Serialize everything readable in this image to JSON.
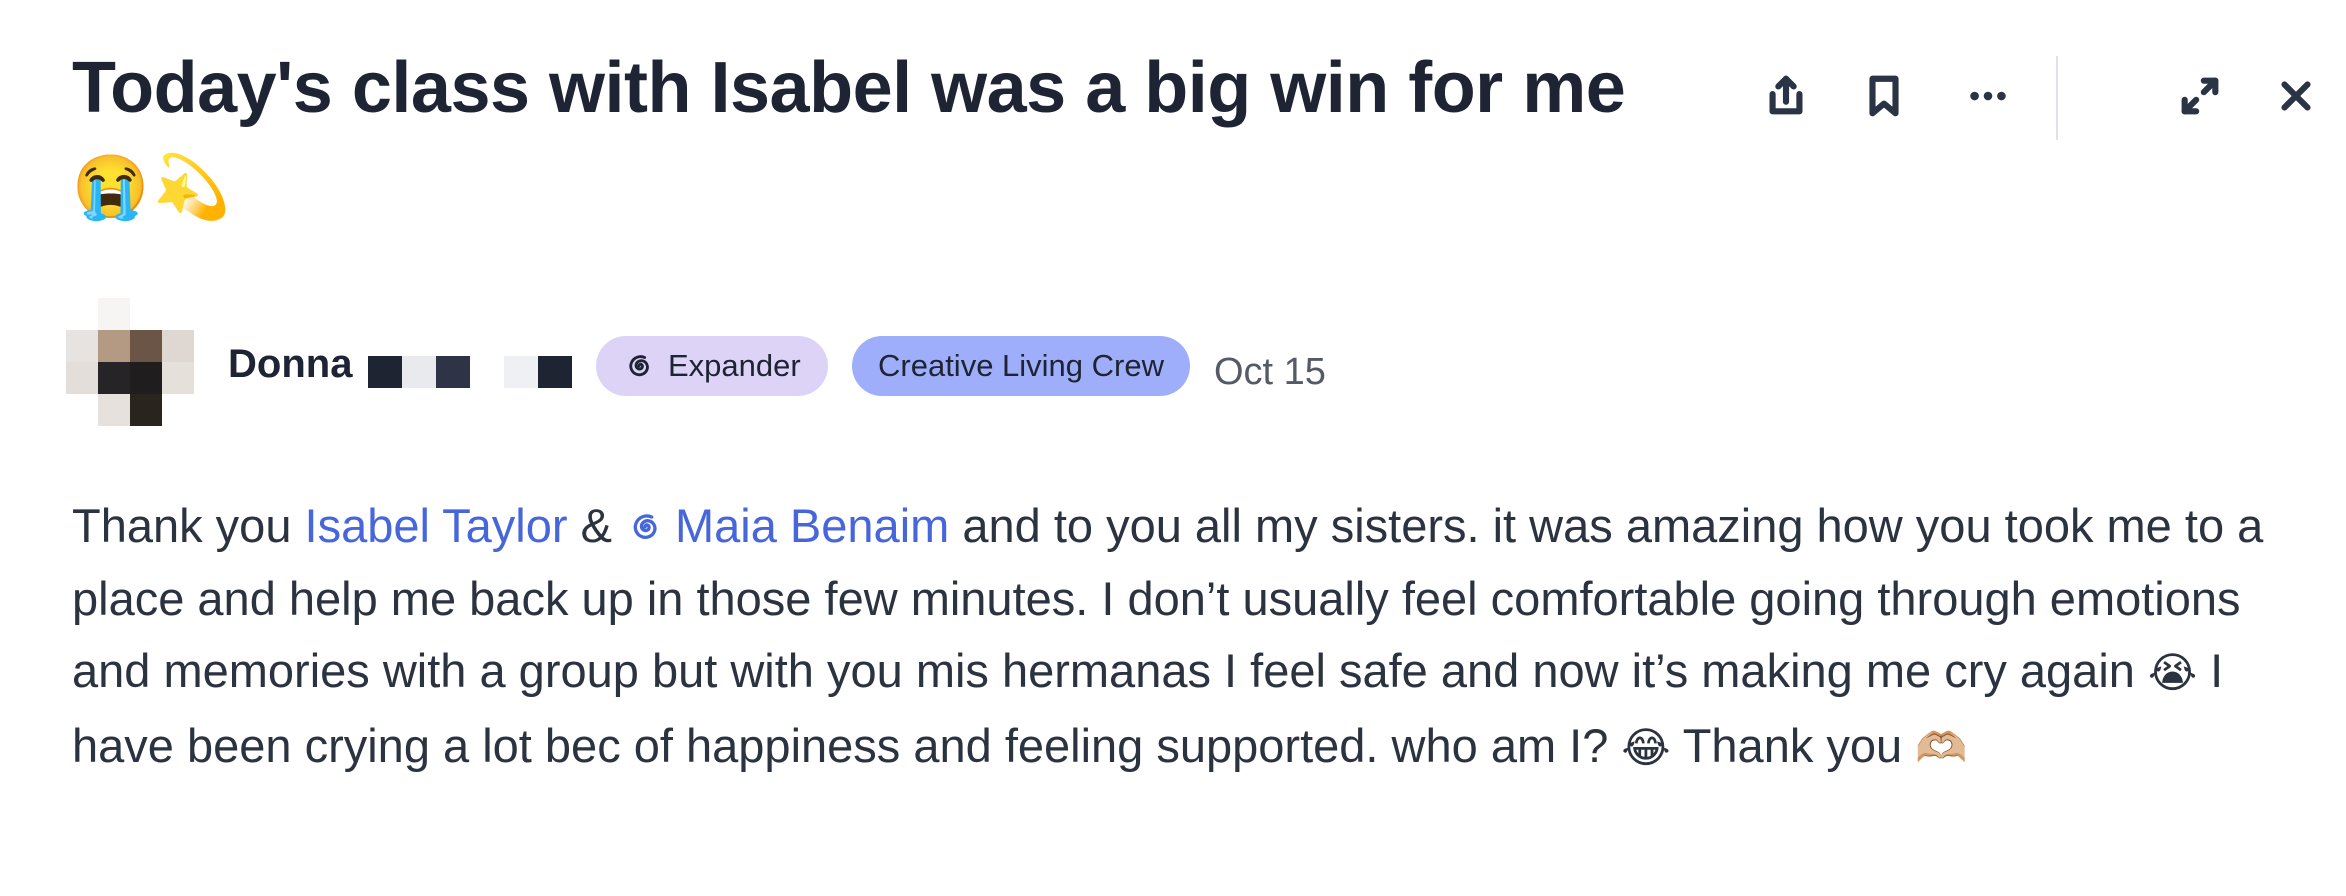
{
  "post": {
    "title": "Today's class with Isabel was a big win for me",
    "title_emoji": "😭💫",
    "author": {
      "name": "Donna",
      "badge_level": "Expander",
      "badge_group": "Creative Living Crew",
      "date": "Oct 15"
    },
    "body": {
      "t1": "Thank you ",
      "mention1": "Isabel Taylor",
      "t2": " & ",
      "mention2": "Maia Benaim",
      "t3": " and to you all my sisters. it was amazing how you took me to a place and help me back up in those few minutes. I don’t usually feel comfortable going through emotions and memories with a group but with you mis hermanas I feel safe and now it’s making me cry again ",
      "e1": "😭",
      "t4": " I have been crying a lot bec of happiness and feeling supported. who am I? ",
      "e2": "😂",
      "t5": " Thank you ",
      "e3": "🫶🏼"
    }
  },
  "toolbar": {
    "icons": [
      "share-icon",
      "bookmark-icon",
      "more-icon",
      "expand-icon",
      "close-icon"
    ]
  },
  "colors": {
    "title": "#1e2433",
    "mention": "#4766db",
    "badge_expander_bg": "#dcd3f7",
    "badge_group_bg": "#9eaefa",
    "date": "#555b66"
  }
}
